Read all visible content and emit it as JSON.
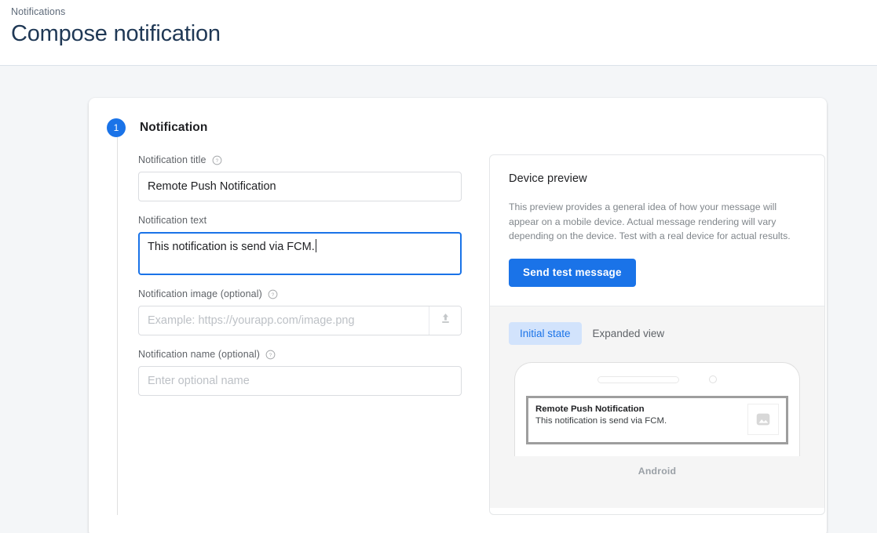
{
  "header": {
    "breadcrumb": "Notifications",
    "title": "Compose notification"
  },
  "colors": {
    "accent": "#1a73e8",
    "chip_active_bg": "#d2e3fc",
    "page_bg": "#f4f6f8",
    "title_color": "#1f3855"
  },
  "step": {
    "number": "1",
    "title": "Notification"
  },
  "form": {
    "title_field": {
      "label": "Notification title",
      "value": "Remote Push Notification",
      "help_icon": "help-circle-icon"
    },
    "text_field": {
      "label": "Notification text",
      "value": "This notification is send via FCM.",
      "focused": true
    },
    "image_field": {
      "label": "Notification image (optional)",
      "placeholder": "Example: https://yourapp.com/image.png",
      "value": "",
      "upload_icon": "upload-icon",
      "help_icon": "help-circle-icon"
    },
    "name_field": {
      "label": "Notification name (optional)",
      "placeholder": "Enter optional name",
      "value": "",
      "help_icon": "help-circle-icon"
    }
  },
  "preview": {
    "title": "Device preview",
    "description": "This preview provides a general idea of how your message will appear on a mobile device. Actual message rendering will vary depending on the device. Test with a real device for actual results.",
    "send_test_label": "Send test message",
    "tabs": [
      {
        "label": "Initial state",
        "active": true
      },
      {
        "label": "Expanded view",
        "active": false
      }
    ],
    "notification": {
      "title": "Remote Push Notification",
      "body": "This notification is send via FCM.",
      "thumb_icon": "image-placeholder-icon"
    },
    "platform_label": "Android"
  }
}
